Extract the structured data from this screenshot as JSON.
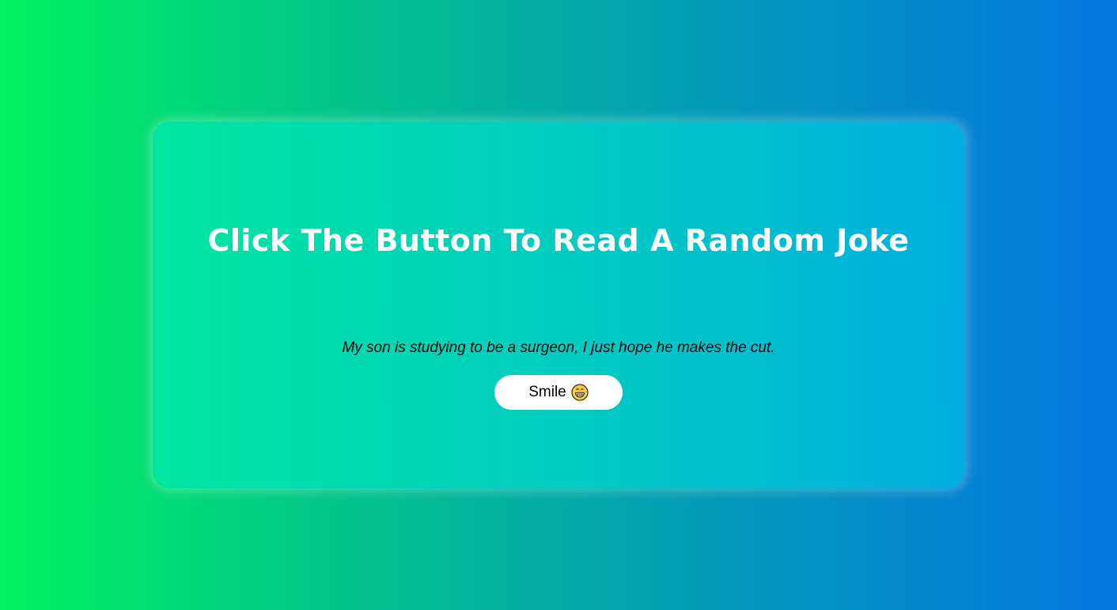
{
  "card": {
    "title": "Click The Button To Read A Random Joke",
    "joke": "My son is studying to be a surgeon, I just hope he makes the cut.",
    "button": {
      "label": "Smile",
      "icon": "grinning-face-icon"
    }
  },
  "colors": {
    "background_left": "#00f260",
    "background_right": "#0476e0",
    "card_left": "#00e6a0",
    "card_right": "#00aede",
    "title": "#ffffff",
    "button_bg": "#ffffff"
  }
}
